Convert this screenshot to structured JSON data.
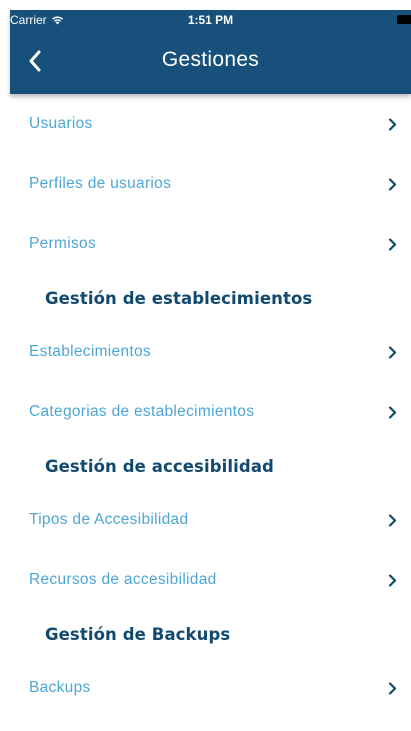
{
  "status_bar": {
    "carrier": "Carrier",
    "time": "1:51 PM",
    "wifi_icon": "wifi-icon",
    "battery_icon": "battery-icon"
  },
  "navbar": {
    "title": "Gestiones",
    "back_icon": "chevron-left-icon",
    "background_color": "#17507a"
  },
  "sections": [
    {
      "header": "",
      "items": [
        {
          "label": "Usuarios"
        },
        {
          "label": "Perfiles de usuarios"
        },
        {
          "label": "Permisos"
        }
      ]
    },
    {
      "header": "Gestión de establecimientos",
      "items": [
        {
          "label": "Establecimientos"
        },
        {
          "label": "Categorias de establecimientos"
        }
      ]
    },
    {
      "header": "Gestión de accesibilidad",
      "items": [
        {
          "label": "Tipos de Accesibilidad"
        },
        {
          "label": "Recursos de accesibilidad"
        }
      ]
    },
    {
      "header": "Gestión de Backups",
      "items": [
        {
          "label": "Backups"
        }
      ]
    }
  ],
  "colors": {
    "item_text": "#4ea6d6",
    "section_header_text": "#12496e",
    "chevron": "#12496e"
  }
}
